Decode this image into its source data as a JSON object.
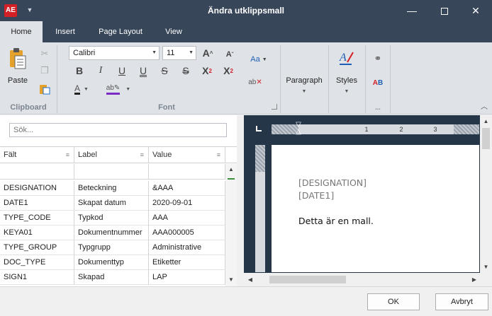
{
  "window": {
    "title": "Ändra utklippsmall",
    "logo_text": "AE"
  },
  "ribbon_tabs": [
    "Home",
    "Insert",
    "Page Layout",
    "View"
  ],
  "clipboard": {
    "paste_label": "Paste",
    "group_label": "Clipboard"
  },
  "font": {
    "family": "Calibri",
    "size": "11",
    "group_label": "Font"
  },
  "paragraph_label": "Paragraph",
  "styles_label": "Styles",
  "more_label": "...",
  "search": {
    "placeholder": "Sök..."
  },
  "grid": {
    "columns": [
      "Fält",
      "Label",
      "Value"
    ],
    "rows": [
      [
        "DESIGNATION",
        "Beteckning",
        "&AAA"
      ],
      [
        "DATE1",
        "Skapat datum",
        "2020-09-01"
      ],
      [
        "TYPE_CODE",
        "Typkod",
        "AAA"
      ],
      [
        "KEYA01",
        "Dokumentnummer",
        "AAA000005"
      ],
      [
        "TYPE_GROUP",
        "Typgrupp",
        "Administrative"
      ],
      [
        "DOC_TYPE",
        "Dokumenttyp",
        "Etiketter"
      ],
      [
        "SIGN1",
        "Skapad",
        "LAP"
      ]
    ]
  },
  "editor": {
    "lines": [
      "[DESIGNATION]",
      "[DATE1]"
    ],
    "body": "Detta är en mall.",
    "ruler_numbers": [
      "1",
      "2",
      "3"
    ]
  },
  "buttons": {
    "ok": "OK",
    "cancel": "Avbryt"
  },
  "colors": {
    "titlebar": "#374659",
    "editor_bg": "#263649",
    "logo": "#d32027"
  }
}
